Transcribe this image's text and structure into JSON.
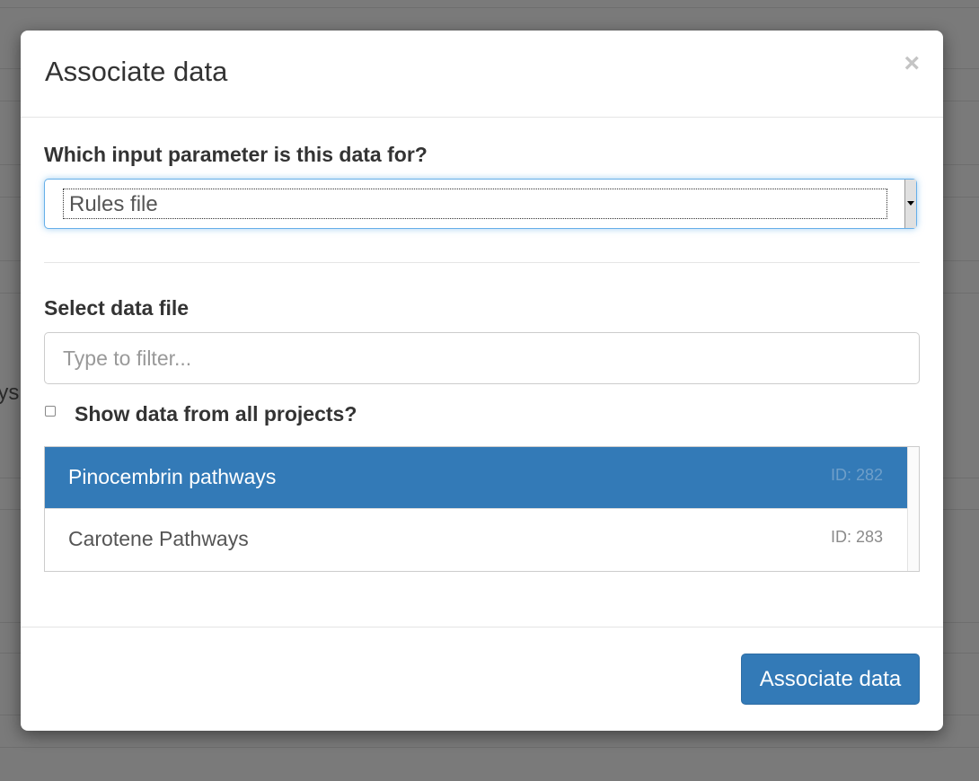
{
  "background": {
    "partial_text": "lys"
  },
  "modal": {
    "title": "Associate data",
    "close_symbol": "×",
    "parameter_label": "Which input parameter is this data for?",
    "parameter_select": {
      "selected": "Rules file"
    },
    "data_file_label": "Select data file",
    "filter": {
      "value": "",
      "placeholder": "Type to filter..."
    },
    "show_all": {
      "label": "Show data from all projects?",
      "checked": false
    },
    "data_files": [
      {
        "name": "Pinocembrin pathways",
        "id": "ID: 282",
        "selected": true
      },
      {
        "name": "Carotene Pathways",
        "id": "ID: 283",
        "selected": false
      }
    ],
    "submit_label": "Associate data"
  },
  "colors": {
    "primary": "#337ab7",
    "backdrop": "#7a7a7a"
  }
}
